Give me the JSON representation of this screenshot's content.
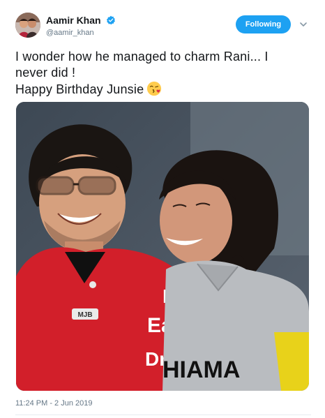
{
  "user": {
    "display_name": "Aamir Khan",
    "handle": "@aamir_khan",
    "verified": true
  },
  "follow_button": {
    "label": "Following"
  },
  "menu_icon": "chevron-down-icon",
  "tweet": {
    "line1": "I wonder how he managed to charm Rani... I",
    "line2": "never did !",
    "line3": "Happy Birthday Junsie",
    "emoji": "face-blowing-kiss"
  },
  "photo": {
    "shirt_text_1": "I",
    "shirt_text_2": "Eat",
    "shirt_text_3": "Dr",
    "jersey_text": "HIAMA",
    "badge_text": "MJB"
  },
  "timestamp": "11:24 PM - 2 Jun 2019",
  "colors": {
    "accent": "#1da1f2",
    "text": "#14171a",
    "muted": "#657786"
  }
}
